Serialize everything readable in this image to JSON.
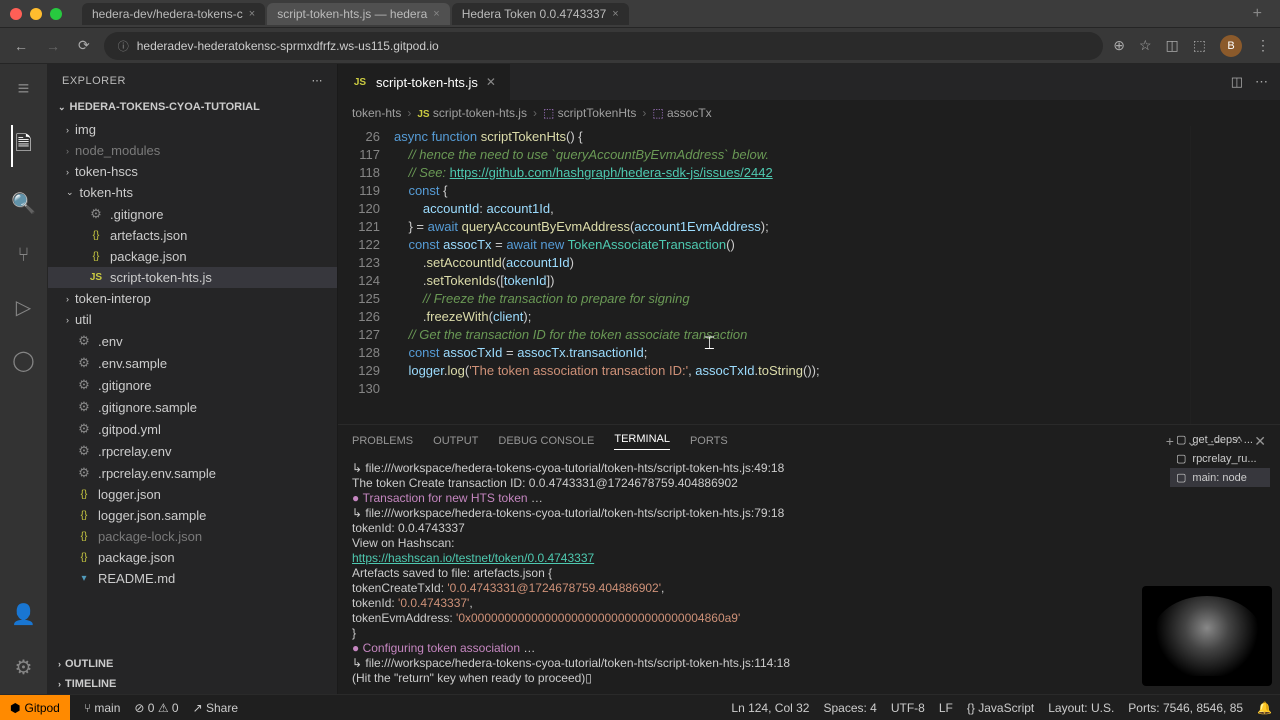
{
  "macos": {
    "tabs": [
      {
        "label": "hedera-dev/hedera-tokens-c"
      },
      {
        "label": "script-token-hts.js — hedera",
        "active": true
      },
      {
        "label": "Hedera Token 0.0.4743337"
      }
    ]
  },
  "browser": {
    "url": "hederadev-hederatokensc-sprmxdfrfz.ws-us115.gitpod.io",
    "avatar": "B"
  },
  "explorer": {
    "title": "EXPLORER",
    "project": "HEDERA-TOKENS-CYOA-TUTORIAL",
    "tree": [
      {
        "t": "folder",
        "name": "img",
        "chev": "›"
      },
      {
        "t": "folder",
        "name": "node_modules",
        "chev": "›",
        "dim": true
      },
      {
        "t": "folder",
        "name": "token-hscs",
        "chev": "›"
      },
      {
        "t": "folder",
        "name": "token-hts",
        "chev": "⌄",
        "open": true
      },
      {
        "t": "file",
        "nested": true,
        "name": ".gitignore",
        "icon": "gear"
      },
      {
        "t": "file",
        "nested": true,
        "name": "artefacts.json",
        "icon": "json"
      },
      {
        "t": "file",
        "nested": true,
        "name": "package.json",
        "icon": "json"
      },
      {
        "t": "file",
        "nested": true,
        "name": "script-token-hts.js",
        "icon": "js",
        "active": true
      },
      {
        "t": "folder",
        "name": "token-interop",
        "chev": "›"
      },
      {
        "t": "folder",
        "name": "util",
        "chev": "›"
      },
      {
        "t": "file",
        "name": ".env",
        "icon": "gear"
      },
      {
        "t": "file",
        "name": ".env.sample",
        "icon": "gear"
      },
      {
        "t": "file",
        "name": ".gitignore",
        "icon": "gear"
      },
      {
        "t": "file",
        "name": ".gitignore.sample",
        "icon": "gear"
      },
      {
        "t": "file",
        "name": ".gitpod.yml",
        "icon": "gear"
      },
      {
        "t": "file",
        "name": ".rpcrelay.env",
        "icon": "gear"
      },
      {
        "t": "file",
        "name": ".rpcrelay.env.sample",
        "icon": "gear"
      },
      {
        "t": "file",
        "name": "logger.json",
        "icon": "json"
      },
      {
        "t": "file",
        "name": "logger.json.sample",
        "icon": "json"
      },
      {
        "t": "file",
        "name": "package-lock.json",
        "icon": "json",
        "dim": true
      },
      {
        "t": "file",
        "name": "package.json",
        "icon": "json"
      },
      {
        "t": "file",
        "name": "README.md",
        "icon": "md"
      }
    ],
    "outline": "OUTLINE",
    "timeline": "TIMELINE"
  },
  "editor": {
    "tab": "script-token-hts.js",
    "breadcrumb": [
      "token-hts",
      "script-token-hts.js",
      "scriptTokenHts",
      "assocTx"
    ],
    "signatureLine": "26",
    "signature": "async function scriptTokenHts() {",
    "lines": [
      {
        "n": "117",
        "html": "    <span class='cm'>// hence the need to use `queryAccountByEvmAddress` below.</span>"
      },
      {
        "n": "118",
        "html": "    <span class='cm'>// See: </span><span class='url'>https://github.com/hashgraph/hedera-sdk-js/issues/2442</span>"
      },
      {
        "n": "119",
        "html": "    <span class='kw'>const</span> {"
      },
      {
        "n": "120",
        "html": "        <span class='var'>accountId</span>: <span class='var'>account1Id</span>,"
      },
      {
        "n": "121",
        "html": "    } = <span class='kw'>await</span> <span class='fn'>queryAccountByEvmAddress</span>(<span class='var'>account1EvmAddress</span>);"
      },
      {
        "n": "122",
        "html": "    <span class='kw'>const</span> <span class='var'>assocTx</span> = <span class='kw'>await</span> <span class='kw'>new</span> <span class='cl'>TokenAssociateTransaction</span>()"
      },
      {
        "n": "123",
        "html": "        .<span class='fn'>setAccountId</span>(<span class='var'>account1Id</span>)"
      },
      {
        "n": "124",
        "html": "        .<span class='fn'>setTokenIds</span>([<span class='var'>tokenId</span>])"
      },
      {
        "n": "125",
        "html": "        <span class='cm'>// Freeze the transaction to prepare for signing</span>"
      },
      {
        "n": "126",
        "html": "        .<span class='fn'>freezeWith</span>(<span class='var'>client</span>);"
      },
      {
        "n": "127",
        "html": ""
      },
      {
        "n": "128",
        "html": "    <span class='cm'>// Get the transaction ID for the token associate transaction</span>"
      },
      {
        "n": "129",
        "html": "    <span class='kw'>const</span> <span class='var'>assocTxId</span> = <span class='var'>assocTx</span>.<span class='var'>transactionId</span>;"
      },
      {
        "n": "130",
        "html": "    <span class='var'>logger</span>.<span class='fn'>log</span>(<span class='str'>'The token association transaction ID:'</span>, <span class='var'>assocTxId</span>.<span class='fn'>toString</span>());"
      }
    ]
  },
  "panel": {
    "tabs": [
      "PROBLEMS",
      "OUTPUT",
      "DEBUG CONSOLE",
      "TERMINAL",
      "PORTS"
    ],
    "activeTab": "TERMINAL",
    "terminals": [
      {
        "name": "get_deps: ..."
      },
      {
        "name": "rpcrelay_ru..."
      },
      {
        "name": "main: node",
        "active": true
      }
    ],
    "lines": [
      {
        "html": "↳ <span class='t-path'>file:///workspace/hedera-tokens-cyoa-tutorial/token-hts/script-token-hts.js:49:18</span>"
      },
      {
        "html": "The token Create transaction ID:  0.0.4743331@1724678759.404886902"
      },
      {
        "html": ""
      },
      {
        "html": "<span class='t-bullet'>●</span> <span class='t-mag'>Transaction for new HTS token</span>  …"
      },
      {
        "html": "↳ <span class='t-path'>file:///workspace/hedera-tokens-cyoa-tutorial/token-hts/script-token-hts.js:79:18</span>"
      },
      {
        "html": "tokenId: 0.0.4743337"
      },
      {
        "html": "View on Hashscan:"
      },
      {
        "html": "  <span class='t-url'>https://hashscan.io/testnet/token/0.0.4743337</span>"
      },
      {
        "html": "Artefacts saved to file: artefacts.json {"
      },
      {
        "html": "  tokenCreateTxId: <span class='t-str'>'0.0.4743331@1724678759.404886902'</span>,"
      },
      {
        "html": "  tokenId: <span class='t-str'>'0.0.4743337'</span>,"
      },
      {
        "html": "  tokenEvmAddress: <span class='t-str'>'0x00000000000000000000000000000000004860a9'</span>"
      },
      {
        "html": "}"
      },
      {
        "html": ""
      },
      {
        "html": "<span class='t-bullet'>●</span> <span class='t-mag'>Configuring token association</span>  …"
      },
      {
        "html": "↳ <span class='t-path'>file:///workspace/hedera-tokens-cyoa-tutorial/token-hts/script-token-hts.js:114:18</span>"
      },
      {
        "html": "(Hit the \"return\" key when ready to proceed)▯"
      }
    ]
  },
  "status": {
    "gitpod": "Gitpod",
    "branch": "main",
    "errors": "0",
    "warnings": "0",
    "share": "Share",
    "cursor": "Ln 124, Col 32",
    "spaces": "Spaces: 4",
    "encoding": "UTF-8",
    "eol": "LF",
    "lang": "JavaScript",
    "layout": "Layout: U.S.",
    "ports": "Ports: 7546, 8546, 85"
  }
}
